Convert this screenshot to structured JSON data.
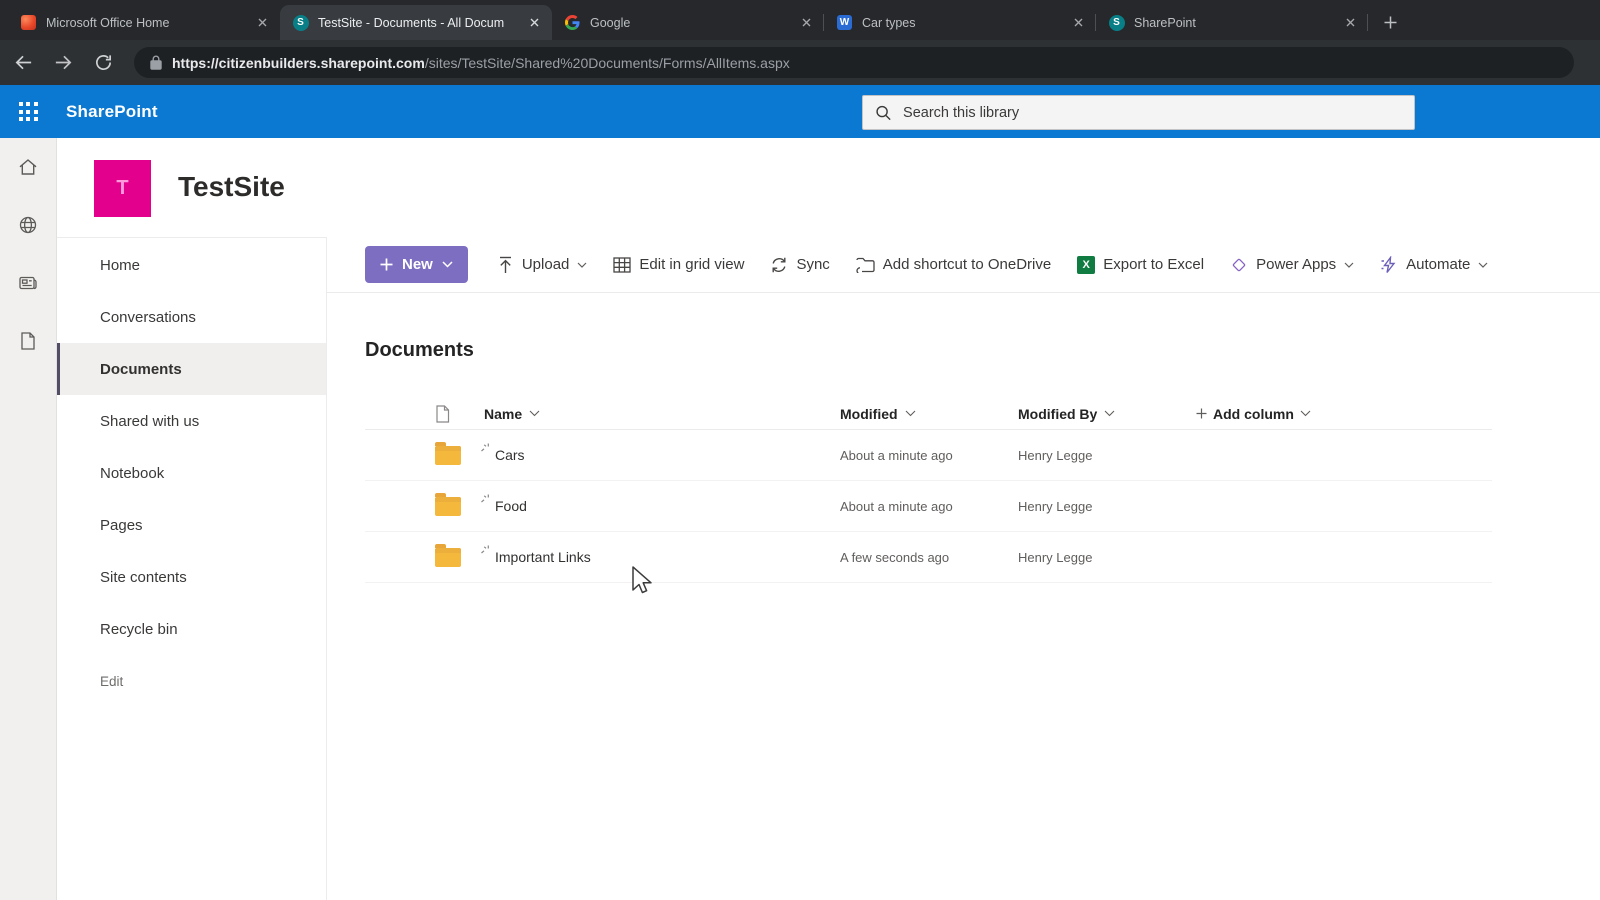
{
  "browser": {
    "tabs": [
      {
        "title": "Microsoft Office Home",
        "icon": "office"
      },
      {
        "title": "TestSite - Documents - All Docum",
        "icon": "sharepoint",
        "active": true
      },
      {
        "title": "Google",
        "icon": "google"
      },
      {
        "title": "Car types",
        "icon": "word"
      },
      {
        "title": "SharePoint",
        "icon": "sharepoint"
      }
    ],
    "url_domain": "https://citizenbuilders.sharepoint.com",
    "url_path": "/sites/TestSite/Shared%20Documents/Forms/AllItems.aspx"
  },
  "suite_bar": {
    "app_name": "SharePoint",
    "search_placeholder": "Search this library"
  },
  "site_header": {
    "title": "TestSite",
    "logo_letter": "T"
  },
  "left_nav": {
    "items": [
      {
        "label": "Home"
      },
      {
        "label": "Conversations"
      },
      {
        "label": "Documents",
        "selected": true
      },
      {
        "label": "Shared with us"
      },
      {
        "label": "Notebook"
      },
      {
        "label": "Pages"
      },
      {
        "label": "Site contents"
      },
      {
        "label": "Recycle bin"
      },
      {
        "label": "Edit"
      }
    ]
  },
  "command_bar": {
    "new_button": "New",
    "commands": [
      {
        "label": "Upload",
        "has_chevron": true
      },
      {
        "label": "Edit in grid view"
      },
      {
        "label": "Sync"
      },
      {
        "label": "Add shortcut to OneDrive"
      },
      {
        "label": "Export to Excel"
      },
      {
        "label": "Power Apps",
        "has_chevron": true
      },
      {
        "label": "Automate",
        "has_chevron": true
      }
    ]
  },
  "library": {
    "title": "Documents",
    "columns": {
      "name": "Name",
      "modified": "Modified",
      "modified_by": "Modified By"
    },
    "add_column_label": "Add column",
    "rows": [
      {
        "name": "Cars",
        "type": "folder",
        "modified": "About a minute ago",
        "modified_by": "Henry Legge"
      },
      {
        "name": "Food",
        "type": "folder",
        "modified": "About a minute ago",
        "modified_by": "Henry Legge"
      },
      {
        "name": "Important Links",
        "type": "folder",
        "modified": "A few seconds ago",
        "modified_by": "Henry Legge"
      }
    ]
  },
  "icons": {
    "word_letter": "W",
    "sharepoint_letter": "S",
    "excel_letter": "X",
    "app_launcher": "waffle-grid",
    "search": "magnifier",
    "rail": [
      "home",
      "globe",
      "news",
      "document"
    ]
  },
  "colors": {
    "suite_bar_blue": "#0b79d1",
    "site_logo_pink": "#e3008c",
    "new_button_purple": "#7e6ec2",
    "excel_green": "#107c41",
    "folder_yellow": "#f4b83d",
    "nav_selected_accent": "#544d66",
    "tabstrip_dark": "#26282b"
  }
}
